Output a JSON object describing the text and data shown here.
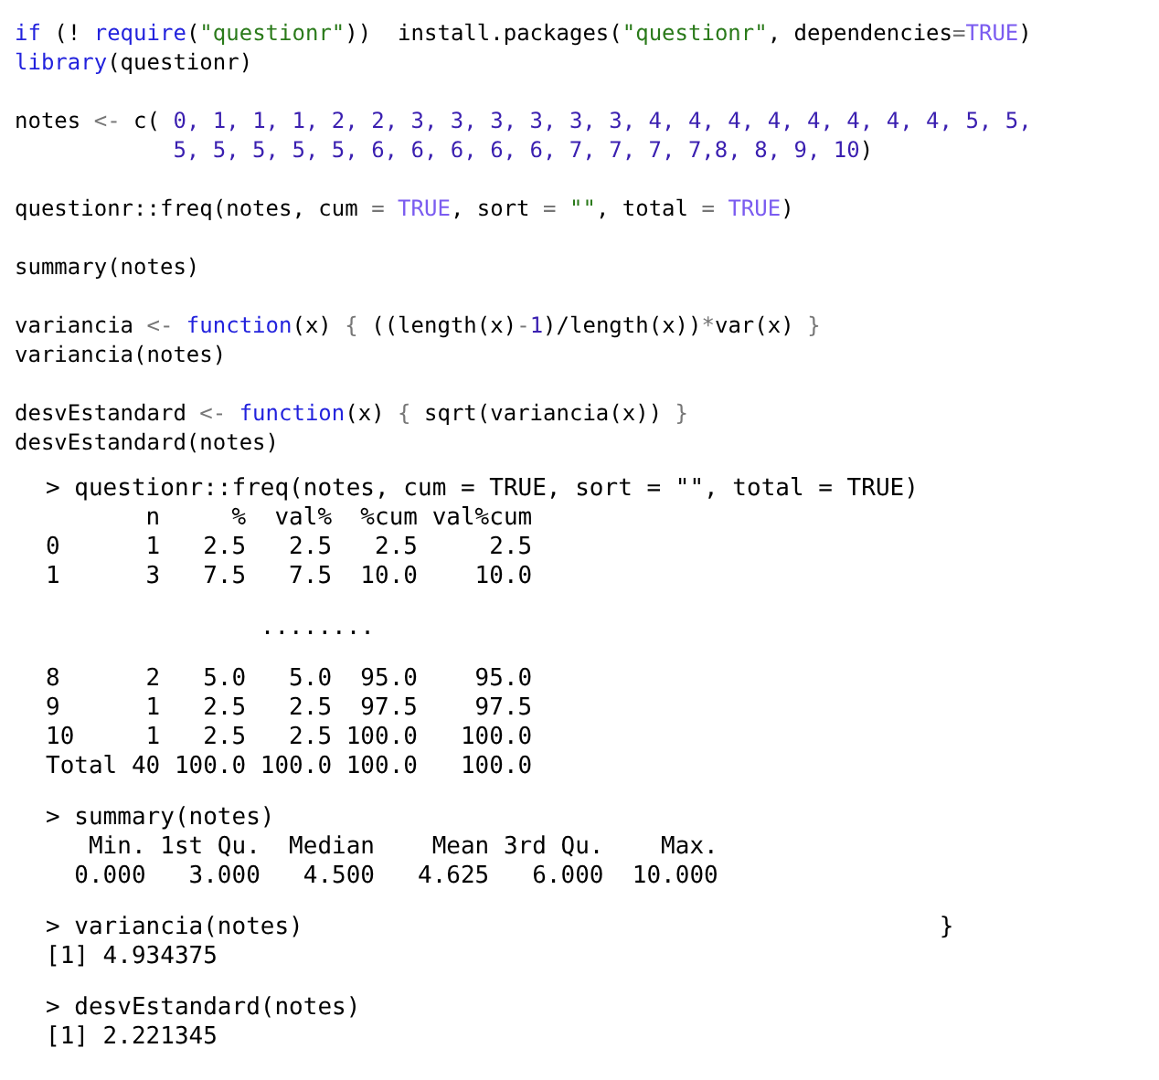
{
  "script": [
    {
      "lines": [
        [
          {
            "kind": "keyword",
            "text": "if"
          },
          {
            "kind": "plain",
            "text": " (! "
          },
          {
            "kind": "keyword",
            "text": "require"
          },
          {
            "kind": "plain",
            "text": "("
          },
          {
            "kind": "string",
            "text": "\"questionr\""
          },
          {
            "kind": "plain",
            "text": "))  install.packages("
          },
          {
            "kind": "string",
            "text": "\"questionr\""
          },
          {
            "kind": "plain",
            "text": ", dependencies"
          },
          {
            "kind": "operator",
            "text": "="
          },
          {
            "kind": "constant",
            "text": "TRUE"
          },
          {
            "kind": "plain",
            "text": ")"
          }
        ],
        [
          {
            "kind": "keyword",
            "text": "library"
          },
          {
            "kind": "plain",
            "text": "(questionr)"
          }
        ]
      ]
    },
    {
      "lines": [
        [
          {
            "kind": "plain",
            "text": "notes "
          },
          {
            "kind": "operator",
            "text": "<-"
          },
          {
            "kind": "plain",
            "text": " c( "
          },
          {
            "kind": "number",
            "text": "0, 1, 1, 1, 2, 2, 3, 3, 3, 3, 3, 3, 4, 4, 4, 4, 4, 4, 4, 4, 5, 5,"
          }
        ],
        [
          {
            "kind": "number",
            "text": "            5, 5, 5, 5, 5, 6, 6, 6, 6, 6, 7, 7, 7, 7,8, 8, 9, 10"
          },
          {
            "kind": "plain",
            "text": ")"
          }
        ]
      ]
    },
    {
      "lines": [
        [
          {
            "kind": "plain",
            "text": "questionr::freq(notes, cum "
          },
          {
            "kind": "operator",
            "text": "="
          },
          {
            "kind": "constant",
            "text": " TRUE"
          },
          {
            "kind": "plain",
            "text": ", sort "
          },
          {
            "kind": "operator",
            "text": "="
          },
          {
            "kind": "string",
            "text": " \"\""
          },
          {
            "kind": "plain",
            "text": ", total "
          },
          {
            "kind": "operator",
            "text": "="
          },
          {
            "kind": "constant",
            "text": " TRUE"
          },
          {
            "kind": "plain",
            "text": ")"
          }
        ]
      ]
    },
    {
      "lines": [
        [
          {
            "kind": "plain",
            "text": "summary(notes)"
          }
        ]
      ]
    },
    {
      "lines": [
        [
          {
            "kind": "plain",
            "text": "variancia "
          },
          {
            "kind": "operator",
            "text": "<-"
          },
          {
            "kind": "keyword",
            "text": " function"
          },
          {
            "kind": "plain",
            "text": "(x) "
          },
          {
            "kind": "operator",
            "text": "{"
          },
          {
            "kind": "plain",
            "text": " ((length(x)"
          },
          {
            "kind": "operator",
            "text": "-"
          },
          {
            "kind": "number",
            "text": "1"
          },
          {
            "kind": "plain",
            "text": ")/length(x))"
          },
          {
            "kind": "operator",
            "text": "*"
          },
          {
            "kind": "plain",
            "text": "var(x) "
          },
          {
            "kind": "operator",
            "text": "}"
          }
        ],
        [
          {
            "kind": "plain",
            "text": "variancia(notes)"
          }
        ]
      ]
    },
    {
      "lines": [
        [
          {
            "kind": "plain",
            "text": "desvEstandard "
          },
          {
            "kind": "operator",
            "text": "<-"
          },
          {
            "kind": "keyword",
            "text": " function"
          },
          {
            "kind": "plain",
            "text": "(x) "
          },
          {
            "kind": "operator",
            "text": "{"
          },
          {
            "kind": "plain",
            "text": " sqrt(variancia(x)) "
          },
          {
            "kind": "operator",
            "text": "}"
          }
        ],
        [
          {
            "kind": "plain",
            "text": "desvEstandard(notes)"
          }
        ]
      ]
    }
  ],
  "console": [
    {
      "lines": [
        {
          "text": "> questionr::freq(notes, cum = TRUE, sort = \"\", total = TRUE)"
        },
        {
          "text": "       n     %  val%  %cum val%cum"
        },
        {
          "text": "0      1   2.5   2.5   2.5     2.5"
        },
        {
          "text": "1      3   7.5   7.5  10.0    10.0"
        }
      ]
    },
    {
      "lines": [
        {
          "text": "               ........"
        }
      ]
    },
    {
      "lines": [
        {
          "text": "8      2   5.0   5.0  95.0    95.0"
        },
        {
          "text": "9      1   2.5   2.5  97.5    97.5"
        },
        {
          "text": "10     1   2.5   2.5 100.0   100.0"
        },
        {
          "text": "Total 40 100.0 100.0 100.0   100.0"
        }
      ]
    },
    {
      "lines": [
        {
          "text": "> summary(notes)"
        },
        {
          "text": "   Min. 1st Qu.  Median    Mean 3rd Qu.    Max. "
        },
        {
          "text": "  0.000   3.000   4.500   4.625   6.000  10.000 "
        }
      ]
    },
    {
      "lines": [
        {
          "text": "> variancia(notes)",
          "aside": "}"
        },
        {
          "text": "[1] 4.934375"
        }
      ]
    },
    {
      "lines": [
        {
          "text": "> desvEstandard(notes)"
        },
        {
          "text": "[1] 2.221345"
        }
      ]
    }
  ]
}
